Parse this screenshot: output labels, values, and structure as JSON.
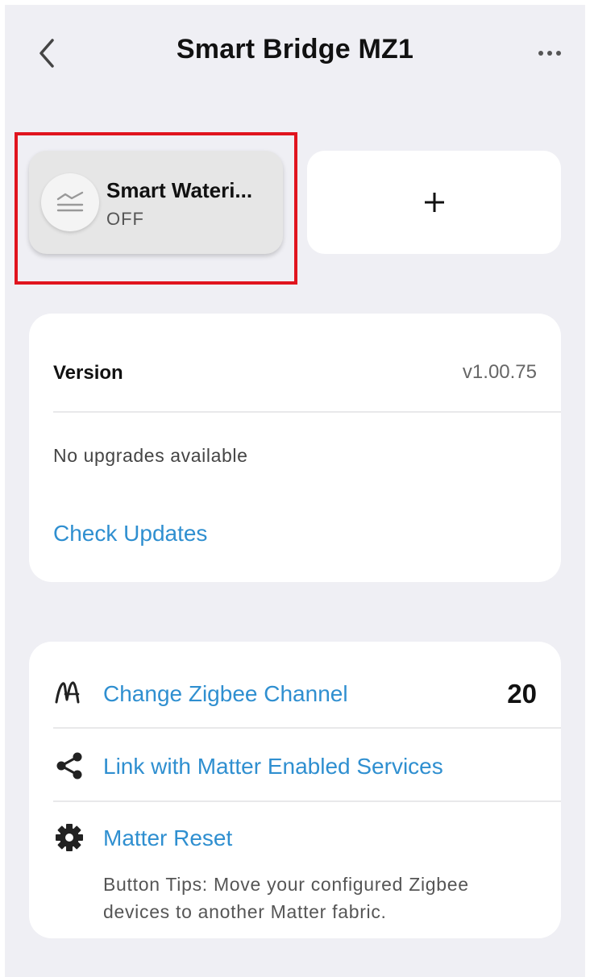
{
  "header": {
    "title": "Smart Bridge MZ1",
    "back_icon": "chevron-left-icon",
    "more_icon": "more-horizontal-icon"
  },
  "device": {
    "name": "Smart Wateri...",
    "status": "OFF",
    "icon": "water-level-icon",
    "highlight_color": "#e0141e"
  },
  "add_card": {
    "label": "+"
  },
  "version_section": {
    "label": "Version",
    "value": "v1.00.75",
    "upgrade_status": "No upgrades available",
    "check_updates_label": "Check Updates"
  },
  "settings": {
    "items": [
      {
        "label": "Change Zigbee Channel",
        "value": "20",
        "icon": "zigbee-icon"
      },
      {
        "label": "Link with Matter Enabled Services",
        "icon": "share-icon"
      },
      {
        "label": "Matter Reset",
        "icon": "gear-icon"
      }
    ],
    "tips": "Button Tips: Move your configured Zigbee devices to another Matter fabric."
  },
  "colors": {
    "accent": "#2f8fd0",
    "background": "#efeff4",
    "card": "#ffffff"
  }
}
